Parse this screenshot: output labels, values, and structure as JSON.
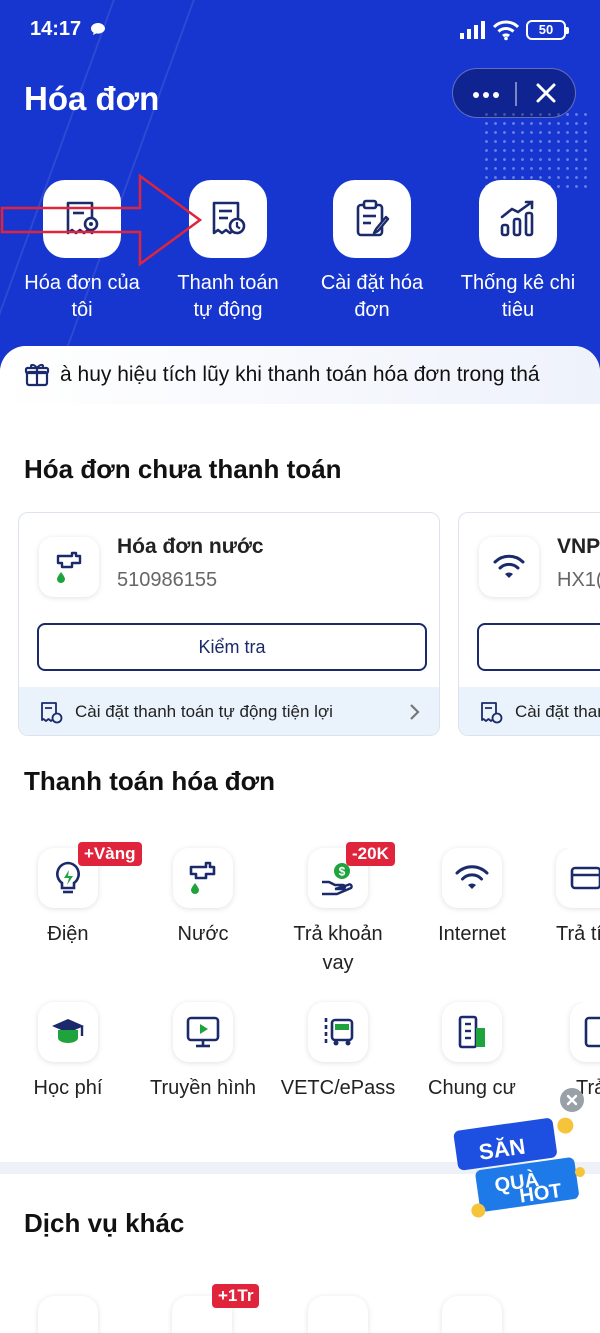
{
  "status_bar": {
    "time": "14:17",
    "battery": "50"
  },
  "header": {
    "title": "Hóa đơn"
  },
  "quick_actions": [
    {
      "label": "Hóa đơn của tôi",
      "icon": "my-bill-icon"
    },
    {
      "label": "Thanh toán tự động",
      "icon": "auto-pay-icon"
    },
    {
      "label": "Cài đặt hóa đơn",
      "icon": "bill-settings-icon"
    },
    {
      "label": "Thống kê chi tiêu",
      "icon": "spending-stats-icon"
    }
  ],
  "promo": {
    "text": "à huy hiệu tích lũy khi thanh toán hóa đơn trong thá"
  },
  "unpaid": {
    "title": "Hóa đơn chưa thanh toán",
    "cards": [
      {
        "name": "Hóa đơn nước",
        "code": "510986155",
        "button": "Kiểm tra",
        "autopay": "Cài đặt thanh toán tự động tiện lợi"
      },
      {
        "name": "VNP",
        "code": "HX1(",
        "autopay": "Cài đặt than"
      }
    ]
  },
  "pay": {
    "title": "Thanh toán hóa đơn",
    "services": [
      {
        "label": "Điện",
        "badge": "+Vàng",
        "icon": "electricity-icon"
      },
      {
        "label": "Nước",
        "icon": "water-icon"
      },
      {
        "label": "Trả khoản vay",
        "badge": "-20K",
        "icon": "loan-icon"
      },
      {
        "label": "Internet",
        "icon": "internet-icon"
      },
      {
        "label": "Trả tí",
        "icon": "credit-icon"
      },
      {
        "label": "Học phí",
        "icon": "tuition-icon"
      },
      {
        "label": "Truyền hình",
        "icon": "tv-icon"
      },
      {
        "label": "VETC/ePass",
        "icon": "vetc-icon"
      },
      {
        "label": "Chung cư",
        "icon": "apartment-icon"
      },
      {
        "label": "Trả",
        "icon": "more-service-icon"
      }
    ]
  },
  "other": {
    "title": "Dịch vụ khác",
    "badge": "+1Tr"
  },
  "floating_promo": {
    "line1": "SĂN",
    "line2": "QUÀ",
    "line3": "HOT"
  },
  "colors": {
    "brand_blue": "#1736cf",
    "navy": "#1b2a6b",
    "badge_red": "#e0243b",
    "green": "#1fa33c"
  }
}
